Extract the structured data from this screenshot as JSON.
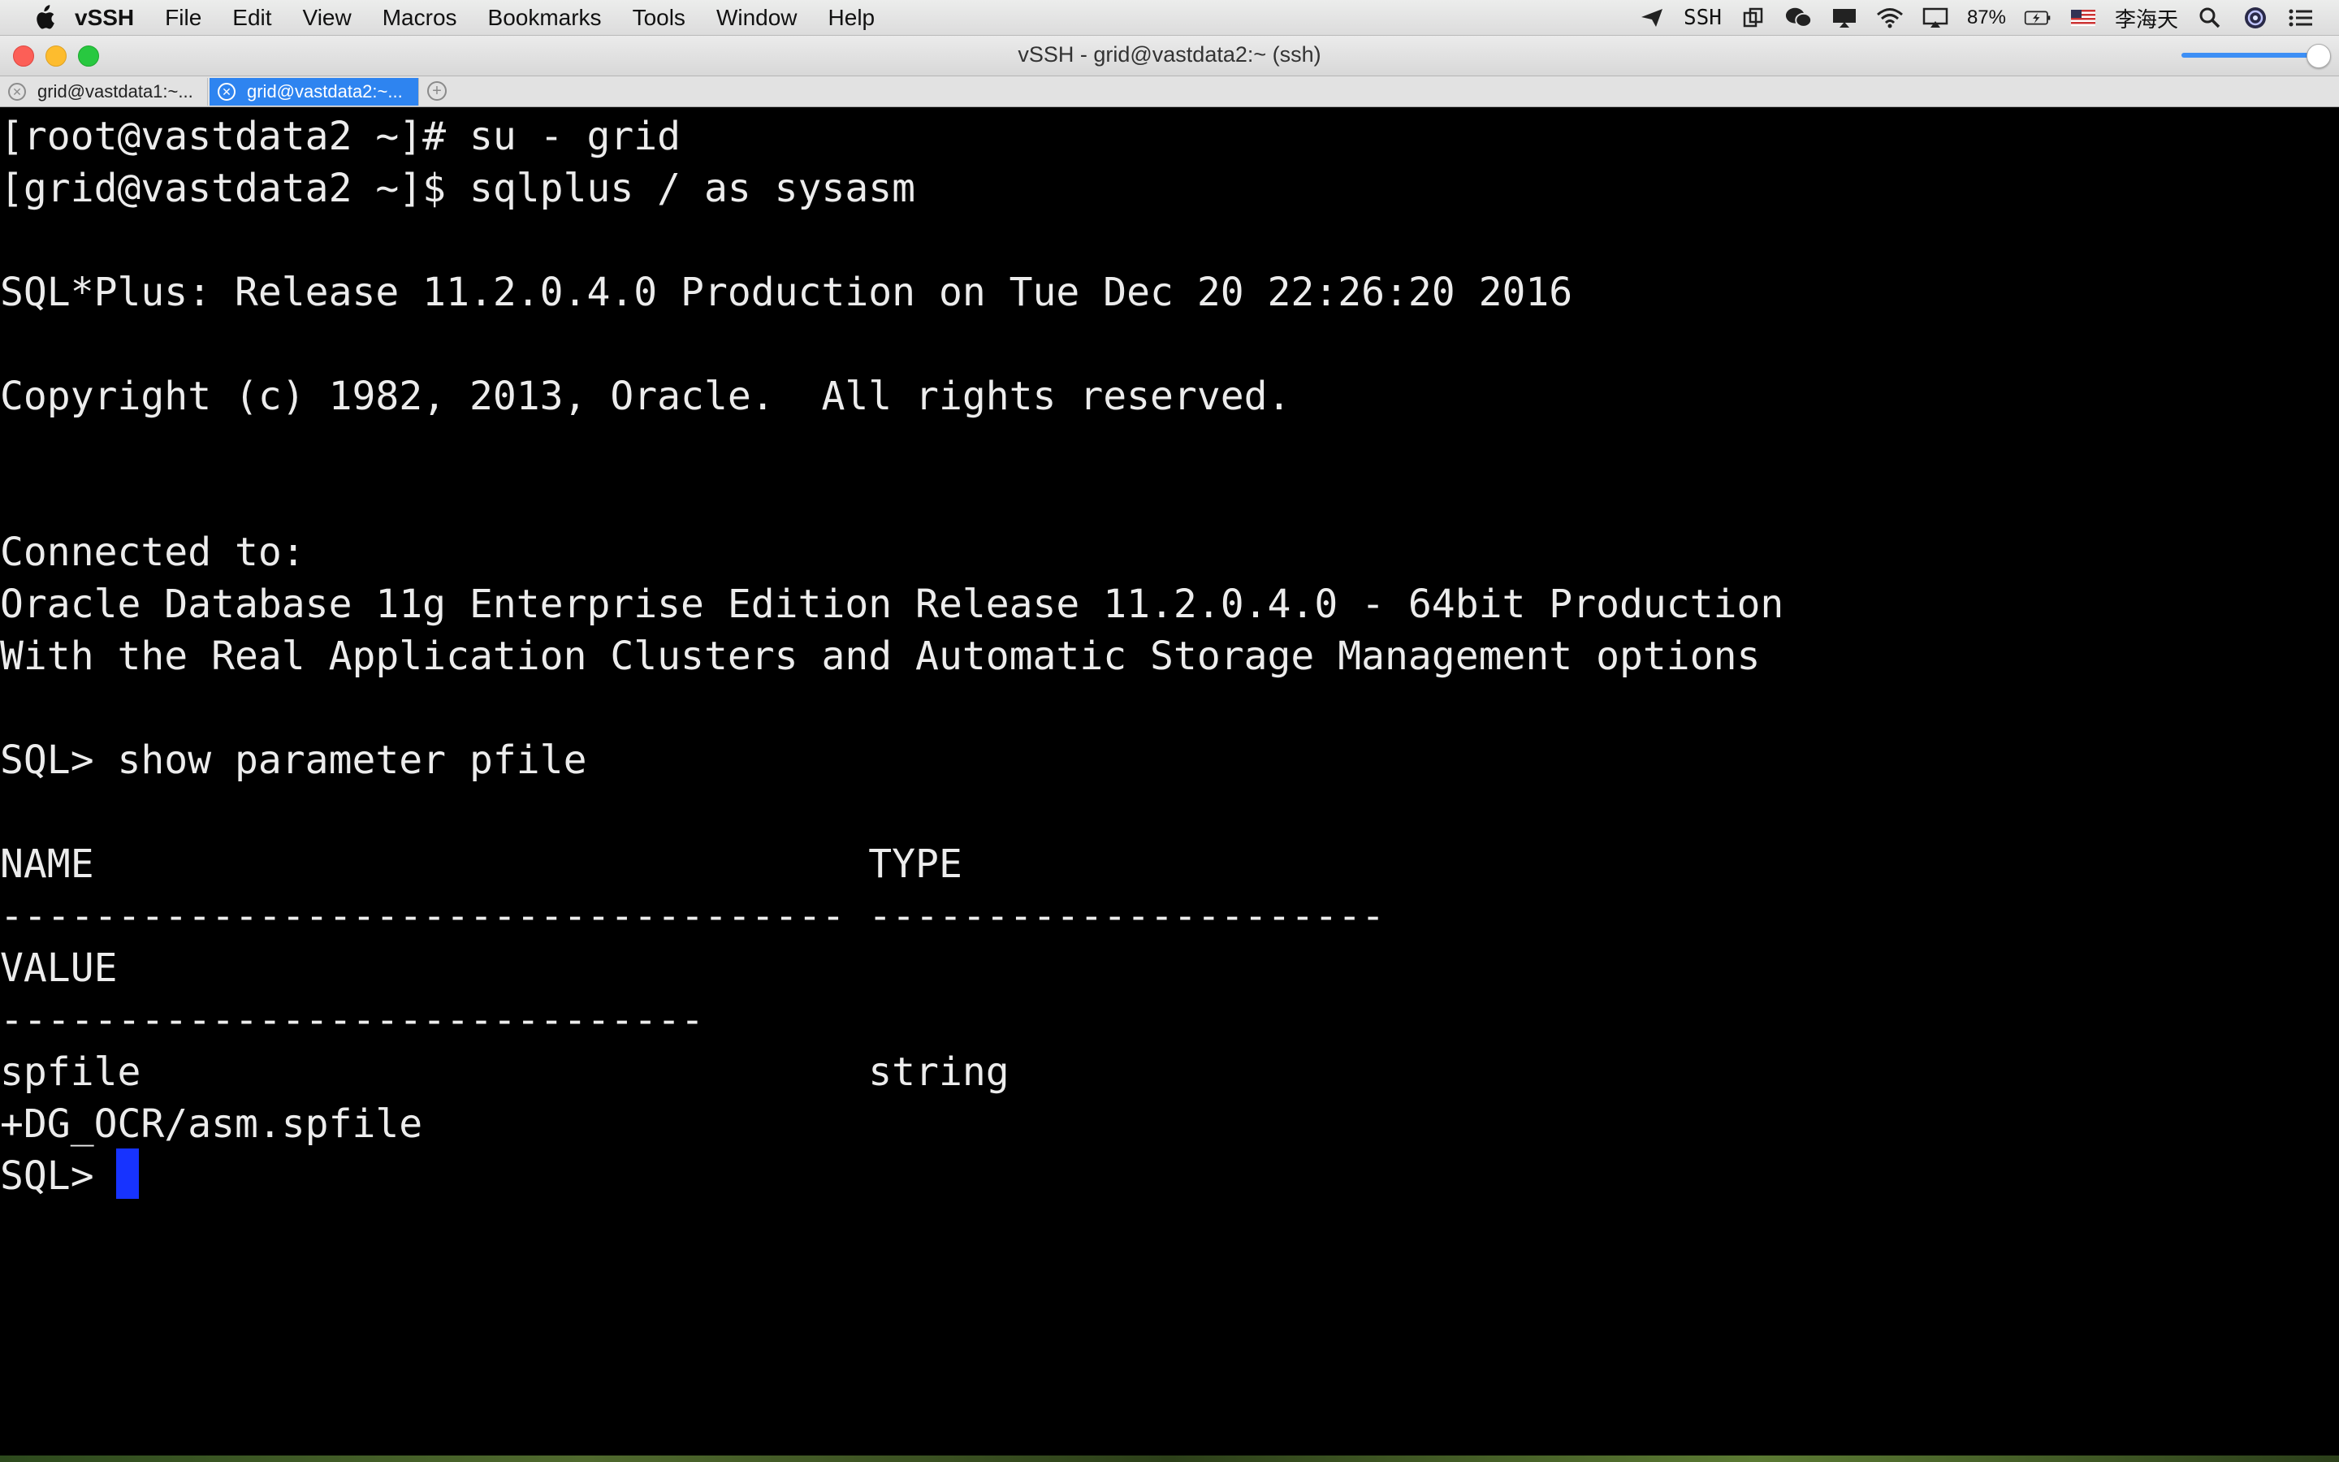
{
  "menubar": {
    "app_name": "vSSH",
    "items": [
      "File",
      "Edit",
      "View",
      "Macros",
      "Bookmarks",
      "Tools",
      "Window",
      "Help"
    ],
    "status": {
      "ssh_label": "SSH",
      "battery": "87%",
      "user_name": "李海天"
    }
  },
  "window": {
    "title": "vSSH - grid@vastdata2:~ (ssh)"
  },
  "tabs": [
    {
      "label": "grid@vastdata1:~..."
    },
    {
      "label": "grid@vastdata2:~..."
    }
  ],
  "terminal": {
    "lines": [
      "[root@vastdata2 ~]# su - grid",
      "[grid@vastdata2 ~]$ sqlplus / as sysasm",
      "SQL*Plus: Release 11.2.0.4.0 Production on Tue Dec 20 22:26:20 2016",
      "Copyright (c) 1982, 2013, Oracle.  All rights reserved.",
      "Connected to:",
      "Oracle Database 11g Enterprise Edition Release 11.2.0.4.0 - 64bit Production",
      "With the Real Application Clusters and Automatic Storage Management options",
      "SQL> show parameter pfile",
      "NAME                                 TYPE",
      "------------------------------------ ----------------------",
      "VALUE",
      "------------------------------",
      "spfile                               string",
      "+DG_OCR/asm.spfile",
      "SQL> "
    ]
  },
  "colors": {
    "terminal_bg": "#000000",
    "terminal_fg": "#ececec",
    "cursor": "#1733ff",
    "active_tab": "#2e84f0"
  }
}
